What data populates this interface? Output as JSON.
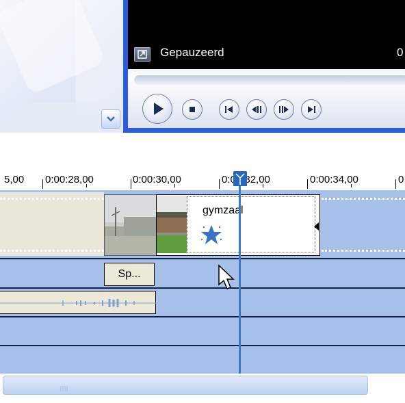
{
  "player": {
    "status_text": "Gepauzeerd",
    "status_right_text": "0",
    "controls": [
      "play",
      "stop",
      "previous-frame",
      "rewind",
      "fast-forward",
      "next-frame"
    ]
  },
  "timeline": {
    "ruler_labels": [
      "5,00",
      "0:00:28,00",
      "0:00:30,00",
      "0:00:32,00",
      "0:00:34,00",
      "0"
    ],
    "clip": {
      "title": "gymzaal",
      "effect_icon": "star-icon"
    },
    "audio_label": "Sp...",
    "playhead_color": "#3a78c8"
  },
  "colors": {
    "track_background": "#a7c0ea",
    "player_frame": "#2c5bdc",
    "clip_background": "#ffffff",
    "beige_clip": "#ebe7d8"
  }
}
